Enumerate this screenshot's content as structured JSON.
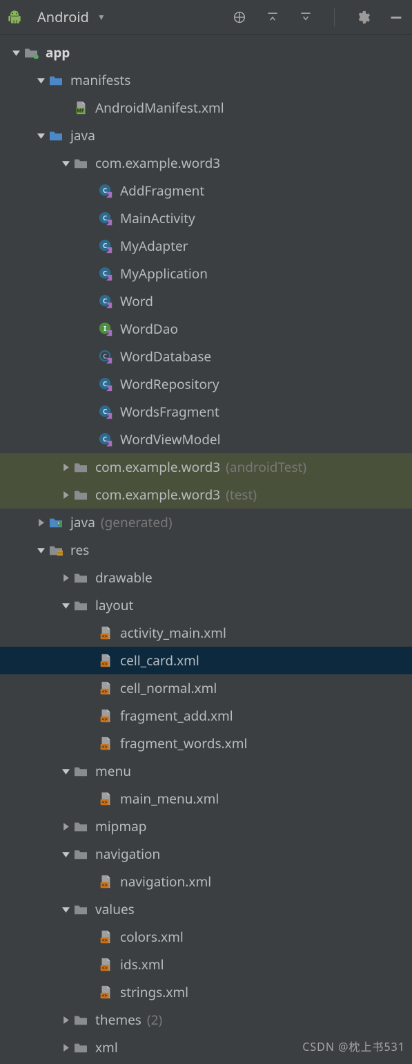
{
  "header": {
    "selector_label": "Android"
  },
  "tree": [
    {
      "depth": 0,
      "arrow": "down",
      "icon": "module",
      "label": "app",
      "bold": true
    },
    {
      "depth": 1,
      "arrow": "down",
      "icon": "folder-blue",
      "label": "manifests"
    },
    {
      "depth": 2,
      "arrow": "none",
      "icon": "manifest",
      "label": "AndroidManifest.xml"
    },
    {
      "depth": 1,
      "arrow": "down",
      "icon": "folder-blue",
      "label": "java"
    },
    {
      "depth": 2,
      "arrow": "down",
      "icon": "folder-gray",
      "label": "com.example.word3"
    },
    {
      "depth": 3,
      "arrow": "none",
      "icon": "kt-class",
      "label": "AddFragment"
    },
    {
      "depth": 3,
      "arrow": "none",
      "icon": "kt-class",
      "label": "MainActivity"
    },
    {
      "depth": 3,
      "arrow": "none",
      "icon": "kt-class",
      "label": "MyAdapter"
    },
    {
      "depth": 3,
      "arrow": "none",
      "icon": "kt-class",
      "label": "MyApplication"
    },
    {
      "depth": 3,
      "arrow": "none",
      "icon": "kt-class",
      "label": "Word"
    },
    {
      "depth": 3,
      "arrow": "none",
      "icon": "kt-interface",
      "label": "WordDao"
    },
    {
      "depth": 3,
      "arrow": "none",
      "icon": "kt-abstract",
      "label": "WordDatabase"
    },
    {
      "depth": 3,
      "arrow": "none",
      "icon": "kt-class",
      "label": "WordRepository"
    },
    {
      "depth": 3,
      "arrow": "none",
      "icon": "kt-class",
      "label": "WordsFragment"
    },
    {
      "depth": 3,
      "arrow": "none",
      "icon": "kt-class",
      "label": "WordViewModel"
    },
    {
      "depth": 2,
      "arrow": "right",
      "icon": "folder-gray",
      "label": "com.example.word3",
      "suffix": "(androidTest)",
      "hl": "test"
    },
    {
      "depth": 2,
      "arrow": "right",
      "icon": "folder-gray",
      "label": "com.example.word3",
      "suffix": "(test)",
      "hl": "test"
    },
    {
      "depth": 1,
      "arrow": "right",
      "icon": "folder-gen",
      "label": "java",
      "suffix": "(generated)"
    },
    {
      "depth": 1,
      "arrow": "down",
      "icon": "folder-res",
      "label": "res"
    },
    {
      "depth": 2,
      "arrow": "right",
      "icon": "folder-gray",
      "label": "drawable"
    },
    {
      "depth": 2,
      "arrow": "down",
      "icon": "folder-gray",
      "label": "layout"
    },
    {
      "depth": 3,
      "arrow": "none",
      "icon": "xml-layout",
      "label": "activity_main.xml"
    },
    {
      "depth": 3,
      "arrow": "none",
      "icon": "xml-layout",
      "label": "cell_card.xml",
      "selected": true
    },
    {
      "depth": 3,
      "arrow": "none",
      "icon": "xml-layout",
      "label": "cell_normal.xml"
    },
    {
      "depth": 3,
      "arrow": "none",
      "icon": "xml-layout",
      "label": "fragment_add.xml"
    },
    {
      "depth": 3,
      "arrow": "none",
      "icon": "xml-layout",
      "label": "fragment_words.xml"
    },
    {
      "depth": 2,
      "arrow": "down",
      "icon": "folder-gray",
      "label": "menu"
    },
    {
      "depth": 3,
      "arrow": "none",
      "icon": "xml-layout",
      "label": "main_menu.xml"
    },
    {
      "depth": 2,
      "arrow": "right",
      "icon": "folder-gray",
      "label": "mipmap"
    },
    {
      "depth": 2,
      "arrow": "down",
      "icon": "folder-gray",
      "label": "navigation"
    },
    {
      "depth": 3,
      "arrow": "none",
      "icon": "xml-layout",
      "label": "navigation.xml"
    },
    {
      "depth": 2,
      "arrow": "down",
      "icon": "folder-gray",
      "label": "values"
    },
    {
      "depth": 3,
      "arrow": "none",
      "icon": "xml-layout",
      "label": "colors.xml"
    },
    {
      "depth": 3,
      "arrow": "none",
      "icon": "xml-layout",
      "label": "ids.xml"
    },
    {
      "depth": 3,
      "arrow": "none",
      "icon": "xml-layout",
      "label": "strings.xml"
    },
    {
      "depth": 2,
      "arrow": "right",
      "icon": "folder-gray",
      "label": "themes",
      "suffix": "(2)"
    },
    {
      "depth": 2,
      "arrow": "right",
      "icon": "folder-gray",
      "label": "xml"
    }
  ],
  "watermark": "CSDN @枕上书531"
}
